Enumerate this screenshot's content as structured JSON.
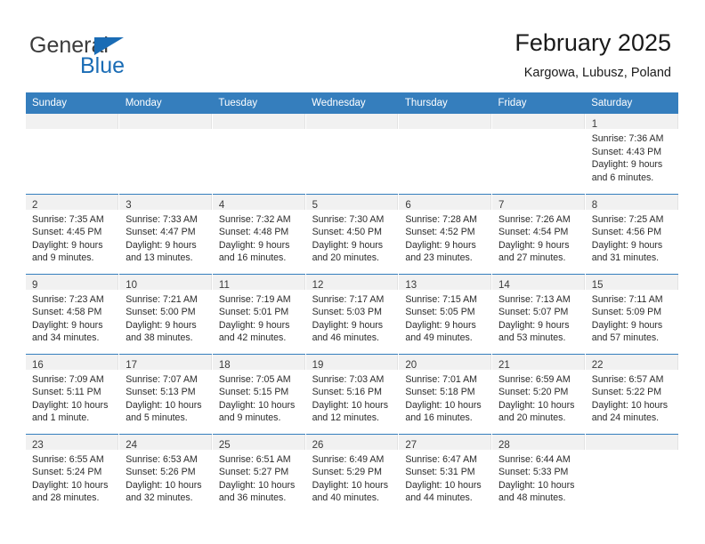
{
  "brand": {
    "name_top": "General",
    "name_bottom": "Blue",
    "accent_color": "#1a6cb5",
    "triangle_icon": "triangle-icon"
  },
  "header": {
    "title": "February 2025",
    "subtitle": "Kargowa, Lubusz, Poland"
  },
  "calendar": {
    "header_bg": "#357ebd",
    "daynum_band_bg": "#f1f1f1",
    "weekday_headers": [
      "Sunday",
      "Monday",
      "Tuesday",
      "Wednesday",
      "Thursday",
      "Friday",
      "Saturday"
    ],
    "weeks": [
      [
        {
          "day": "",
          "sunrise": "",
          "sunset": "",
          "daylight": "",
          "empty": true
        },
        {
          "day": "",
          "sunrise": "",
          "sunset": "",
          "daylight": "",
          "empty": true
        },
        {
          "day": "",
          "sunrise": "",
          "sunset": "",
          "daylight": "",
          "empty": true
        },
        {
          "day": "",
          "sunrise": "",
          "sunset": "",
          "daylight": "",
          "empty": true
        },
        {
          "day": "",
          "sunrise": "",
          "sunset": "",
          "daylight": "",
          "empty": true
        },
        {
          "day": "",
          "sunrise": "",
          "sunset": "",
          "daylight": "",
          "empty": true
        },
        {
          "day": "1",
          "sunrise": "Sunrise: 7:36 AM",
          "sunset": "Sunset: 4:43 PM",
          "daylight": "Daylight: 9 hours and 6 minutes.",
          "empty": false
        }
      ],
      [
        {
          "day": "2",
          "sunrise": "Sunrise: 7:35 AM",
          "sunset": "Sunset: 4:45 PM",
          "daylight": "Daylight: 9 hours and 9 minutes.",
          "empty": false
        },
        {
          "day": "3",
          "sunrise": "Sunrise: 7:33 AM",
          "sunset": "Sunset: 4:47 PM",
          "daylight": "Daylight: 9 hours and 13 minutes.",
          "empty": false
        },
        {
          "day": "4",
          "sunrise": "Sunrise: 7:32 AM",
          "sunset": "Sunset: 4:48 PM",
          "daylight": "Daylight: 9 hours and 16 minutes.",
          "empty": false
        },
        {
          "day": "5",
          "sunrise": "Sunrise: 7:30 AM",
          "sunset": "Sunset: 4:50 PM",
          "daylight": "Daylight: 9 hours and 20 minutes.",
          "empty": false
        },
        {
          "day": "6",
          "sunrise": "Sunrise: 7:28 AM",
          "sunset": "Sunset: 4:52 PM",
          "daylight": "Daylight: 9 hours and 23 minutes.",
          "empty": false
        },
        {
          "day": "7",
          "sunrise": "Sunrise: 7:26 AM",
          "sunset": "Sunset: 4:54 PM",
          "daylight": "Daylight: 9 hours and 27 minutes.",
          "empty": false
        },
        {
          "day": "8",
          "sunrise": "Sunrise: 7:25 AM",
          "sunset": "Sunset: 4:56 PM",
          "daylight": "Daylight: 9 hours and 31 minutes.",
          "empty": false
        }
      ],
      [
        {
          "day": "9",
          "sunrise": "Sunrise: 7:23 AM",
          "sunset": "Sunset: 4:58 PM",
          "daylight": "Daylight: 9 hours and 34 minutes.",
          "empty": false
        },
        {
          "day": "10",
          "sunrise": "Sunrise: 7:21 AM",
          "sunset": "Sunset: 5:00 PM",
          "daylight": "Daylight: 9 hours and 38 minutes.",
          "empty": false
        },
        {
          "day": "11",
          "sunrise": "Sunrise: 7:19 AM",
          "sunset": "Sunset: 5:01 PM",
          "daylight": "Daylight: 9 hours and 42 minutes.",
          "empty": false
        },
        {
          "day": "12",
          "sunrise": "Sunrise: 7:17 AM",
          "sunset": "Sunset: 5:03 PM",
          "daylight": "Daylight: 9 hours and 46 minutes.",
          "empty": false
        },
        {
          "day": "13",
          "sunrise": "Sunrise: 7:15 AM",
          "sunset": "Sunset: 5:05 PM",
          "daylight": "Daylight: 9 hours and 49 minutes.",
          "empty": false
        },
        {
          "day": "14",
          "sunrise": "Sunrise: 7:13 AM",
          "sunset": "Sunset: 5:07 PM",
          "daylight": "Daylight: 9 hours and 53 minutes.",
          "empty": false
        },
        {
          "day": "15",
          "sunrise": "Sunrise: 7:11 AM",
          "sunset": "Sunset: 5:09 PM",
          "daylight": "Daylight: 9 hours and 57 minutes.",
          "empty": false
        }
      ],
      [
        {
          "day": "16",
          "sunrise": "Sunrise: 7:09 AM",
          "sunset": "Sunset: 5:11 PM",
          "daylight": "Daylight: 10 hours and 1 minute.",
          "empty": false
        },
        {
          "day": "17",
          "sunrise": "Sunrise: 7:07 AM",
          "sunset": "Sunset: 5:13 PM",
          "daylight": "Daylight: 10 hours and 5 minutes.",
          "empty": false
        },
        {
          "day": "18",
          "sunrise": "Sunrise: 7:05 AM",
          "sunset": "Sunset: 5:15 PM",
          "daylight": "Daylight: 10 hours and 9 minutes.",
          "empty": false
        },
        {
          "day": "19",
          "sunrise": "Sunrise: 7:03 AM",
          "sunset": "Sunset: 5:16 PM",
          "daylight": "Daylight: 10 hours and 12 minutes.",
          "empty": false
        },
        {
          "day": "20",
          "sunrise": "Sunrise: 7:01 AM",
          "sunset": "Sunset: 5:18 PM",
          "daylight": "Daylight: 10 hours and 16 minutes.",
          "empty": false
        },
        {
          "day": "21",
          "sunrise": "Sunrise: 6:59 AM",
          "sunset": "Sunset: 5:20 PM",
          "daylight": "Daylight: 10 hours and 20 minutes.",
          "empty": false
        },
        {
          "day": "22",
          "sunrise": "Sunrise: 6:57 AM",
          "sunset": "Sunset: 5:22 PM",
          "daylight": "Daylight: 10 hours and 24 minutes.",
          "empty": false
        }
      ],
      [
        {
          "day": "23",
          "sunrise": "Sunrise: 6:55 AM",
          "sunset": "Sunset: 5:24 PM",
          "daylight": "Daylight: 10 hours and 28 minutes.",
          "empty": false
        },
        {
          "day": "24",
          "sunrise": "Sunrise: 6:53 AM",
          "sunset": "Sunset: 5:26 PM",
          "daylight": "Daylight: 10 hours and 32 minutes.",
          "empty": false
        },
        {
          "day": "25",
          "sunrise": "Sunrise: 6:51 AM",
          "sunset": "Sunset: 5:27 PM",
          "daylight": "Daylight: 10 hours and 36 minutes.",
          "empty": false
        },
        {
          "day": "26",
          "sunrise": "Sunrise: 6:49 AM",
          "sunset": "Sunset: 5:29 PM",
          "daylight": "Daylight: 10 hours and 40 minutes.",
          "empty": false
        },
        {
          "day": "27",
          "sunrise": "Sunrise: 6:47 AM",
          "sunset": "Sunset: 5:31 PM",
          "daylight": "Daylight: 10 hours and 44 minutes.",
          "empty": false
        },
        {
          "day": "28",
          "sunrise": "Sunrise: 6:44 AM",
          "sunset": "Sunset: 5:33 PM",
          "daylight": "Daylight: 10 hours and 48 minutes.",
          "empty": false
        },
        {
          "day": "",
          "sunrise": "",
          "sunset": "",
          "daylight": "",
          "empty": true
        }
      ]
    ]
  }
}
